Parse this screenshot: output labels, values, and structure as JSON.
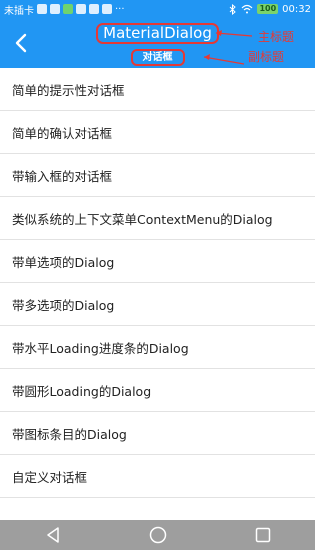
{
  "status_bar": {
    "carrier": "未插卡",
    "more": "···",
    "battery": "100",
    "time": "00:32"
  },
  "toolbar": {
    "title": "MaterialDialog",
    "subtitle": "对话框",
    "back_icon": "back-arrow-icon"
  },
  "annotations": {
    "main_title_label": "主标题",
    "subtitle_label": "副标题",
    "color": "#e53935"
  },
  "list": {
    "items": [
      "简单的提示性对话框",
      "简单的确认对话框",
      "带输入框的对话框",
      "类似系统的上下文菜单ContextMenu的Dialog",
      "带单选项的Dialog",
      "带多选项的Dialog",
      "带水平Loading进度条的Dialog",
      "带圆形Loading的Dialog",
      "带图标条目的Dialog",
      "自定义对话框"
    ]
  },
  "nav_bar": {
    "icons": [
      "nav-back-icon",
      "nav-home-icon",
      "nav-recents-icon"
    ]
  },
  "colors": {
    "primary": "#2196f3",
    "nav_bar": "#9e9e9e"
  }
}
